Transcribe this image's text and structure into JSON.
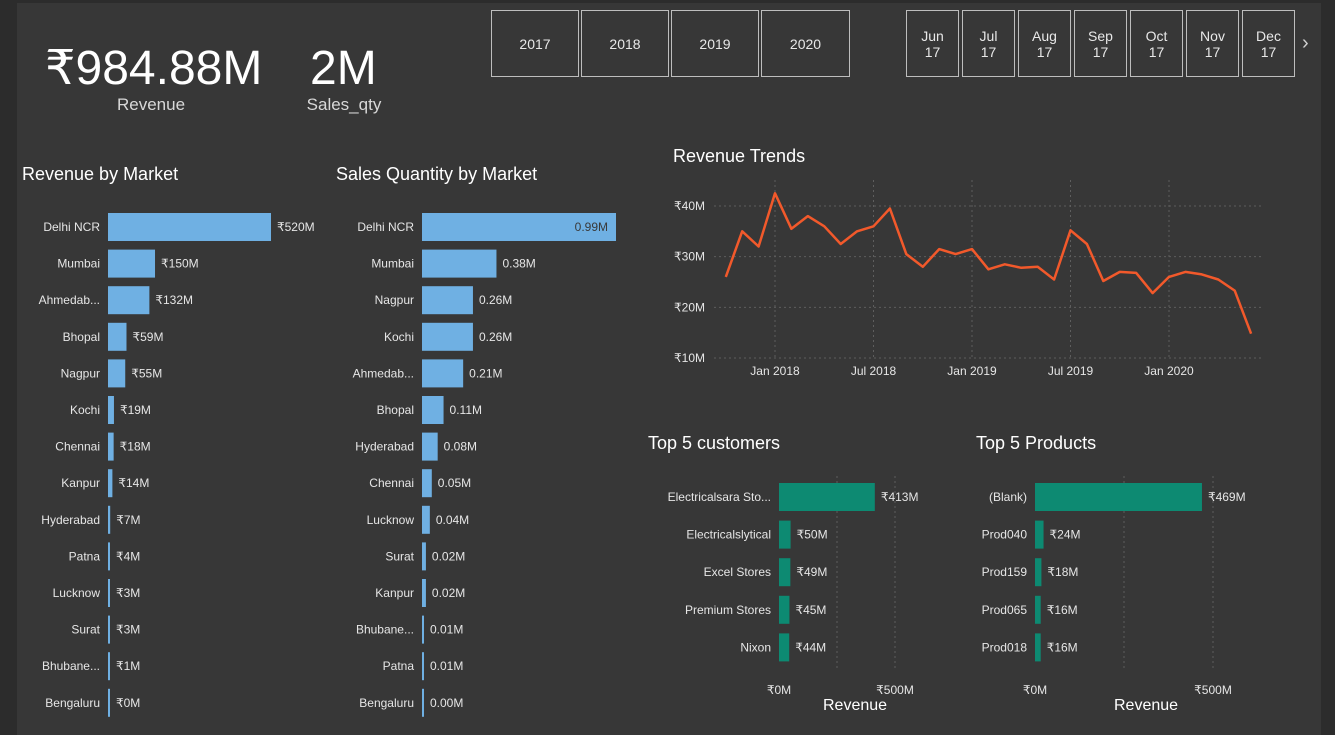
{
  "kpis": {
    "revenue": {
      "value": "₹984.88M",
      "label": "Revenue"
    },
    "sales_qty": {
      "value": "2M",
      "label": "Sales_qty"
    }
  },
  "year_slicer": [
    "2017",
    "2018",
    "2019",
    "2020"
  ],
  "month_slicer": [
    {
      "month": "Jun",
      "year": "17"
    },
    {
      "month": "Jul",
      "year": "17"
    },
    {
      "month": "Aug",
      "year": "17"
    },
    {
      "month": "Sep",
      "year": "17"
    },
    {
      "month": "Oct",
      "year": "17"
    },
    {
      "month": "Nov",
      "year": "17"
    },
    {
      "month": "Dec",
      "year": "17"
    }
  ],
  "colors": {
    "bar_blue": "#6fb0e3",
    "bar_teal": "#0d8a72",
    "line_orange": "#f2592b",
    "background": "#373737",
    "grid": "#5e5e5e"
  },
  "chart_data": [
    {
      "id": "revenue_by_market",
      "type": "bar",
      "orientation": "horizontal",
      "title": "Revenue by Market",
      "categories": [
        "Delhi NCR",
        "Mumbai",
        "Ahmedab...",
        "Bhopal",
        "Nagpur",
        "Kochi",
        "Chennai",
        "Kanpur",
        "Hyderabad",
        "Patna",
        "Lucknow",
        "Surat",
        "Bhubane...",
        "Bengaluru"
      ],
      "values": [
        520,
        150,
        132,
        59,
        55,
        19,
        18,
        14,
        7,
        4,
        3,
        3,
        1,
        0
      ],
      "data_labels": [
        "₹520M",
        "₹150M",
        "₹132M",
        "₹59M",
        "₹55M",
        "₹19M",
        "₹18M",
        "₹14M",
        "₹7M",
        "₹4M",
        "₹3M",
        "₹3M",
        "₹1M",
        "₹0M"
      ],
      "unit": "₹M"
    },
    {
      "id": "sales_qty_by_market",
      "type": "bar",
      "orientation": "horizontal",
      "title": "Sales Quantity by Market",
      "categories": [
        "Delhi NCR",
        "Mumbai",
        "Nagpur",
        "Kochi",
        "Ahmedab...",
        "Bhopal",
        "Hyderabad",
        "Chennai",
        "Lucknow",
        "Surat",
        "Kanpur",
        "Bhubane...",
        "Patna",
        "Bengaluru"
      ],
      "values": [
        0.99,
        0.38,
        0.26,
        0.26,
        0.21,
        0.11,
        0.08,
        0.05,
        0.04,
        0.02,
        0.02,
        0.01,
        0.01,
        0.0
      ],
      "data_labels": [
        "0.99M",
        "0.38M",
        "0.26M",
        "0.26M",
        "0.21M",
        "0.11M",
        "0.08M",
        "0.05M",
        "0.04M",
        "0.02M",
        "0.02M",
        "0.01M",
        "0.01M",
        "0.00M"
      ],
      "unit": "M"
    },
    {
      "id": "revenue_trends",
      "type": "line",
      "title": "Revenue Trends",
      "x": [
        "2017-10",
        "2017-11",
        "2017-12",
        "2018-01",
        "2018-02",
        "2018-03",
        "2018-04",
        "2018-05",
        "2018-06",
        "2018-07",
        "2018-08",
        "2018-09",
        "2018-10",
        "2018-11",
        "2018-12",
        "2019-01",
        "2019-02",
        "2019-03",
        "2019-04",
        "2019-05",
        "2019-06",
        "2019-07",
        "2019-08",
        "2019-09",
        "2019-10",
        "2019-11",
        "2019-12",
        "2020-01",
        "2020-02",
        "2020-03",
        "2020-04",
        "2020-05",
        "2020-06"
      ],
      "values": [
        26.0,
        35.0,
        32.0,
        42.5,
        35.5,
        38.0,
        36.0,
        32.5,
        35.0,
        36.0,
        39.5,
        30.5,
        28.0,
        31.5,
        30.5,
        31.5,
        27.5,
        28.5,
        27.8,
        28.0,
        25.5,
        35.2,
        32.5,
        25.2,
        27.0,
        26.8,
        22.8,
        26.0,
        27.0,
        26.5,
        25.5,
        23.3,
        14.8
      ],
      "yticks": [
        "₹10M",
        "₹20M",
        "₹30M",
        "₹40M"
      ],
      "ytick_values": [
        10,
        20,
        30,
        40
      ],
      "xticks": [
        "Jan 2018",
        "Jul 2018",
        "Jan 2019",
        "Jul 2019",
        "Jan 2020"
      ],
      "xtick_at": [
        "2018-01",
        "2018-07",
        "2019-01",
        "2019-07",
        "2020-01"
      ],
      "ylim": [
        10,
        45
      ],
      "grid": true
    },
    {
      "id": "top5_customers",
      "type": "bar",
      "orientation": "horizontal",
      "title": "Top 5 customers",
      "categories": [
        "Electricalsara Sto...",
        "Electricalslytical",
        "Excel Stores",
        "Premium Stores",
        "Nixon"
      ],
      "values": [
        413,
        50,
        49,
        45,
        44
      ],
      "data_labels": [
        "₹413M",
        "₹50M",
        "₹49M",
        "₹45M",
        "₹44M"
      ],
      "xticks": [
        "₹0M",
        "₹500M"
      ],
      "xtick_values": [
        0,
        500
      ],
      "xlabel": "Revenue",
      "xlim": [
        0,
        500
      ]
    },
    {
      "id": "top5_products",
      "type": "bar",
      "orientation": "horizontal",
      "title": "Top 5 Products",
      "categories": [
        "(Blank)",
        "Prod040",
        "Prod159",
        "Prod065",
        "Prod018"
      ],
      "values": [
        469,
        24,
        18,
        16,
        16
      ],
      "data_labels": [
        "₹469M",
        "₹24M",
        "₹18M",
        "₹16M",
        "₹16M"
      ],
      "xticks": [
        "₹0M",
        "₹500M"
      ],
      "xtick_values": [
        0,
        500
      ],
      "xlabel": "Revenue",
      "xlim": [
        0,
        500
      ]
    }
  ]
}
